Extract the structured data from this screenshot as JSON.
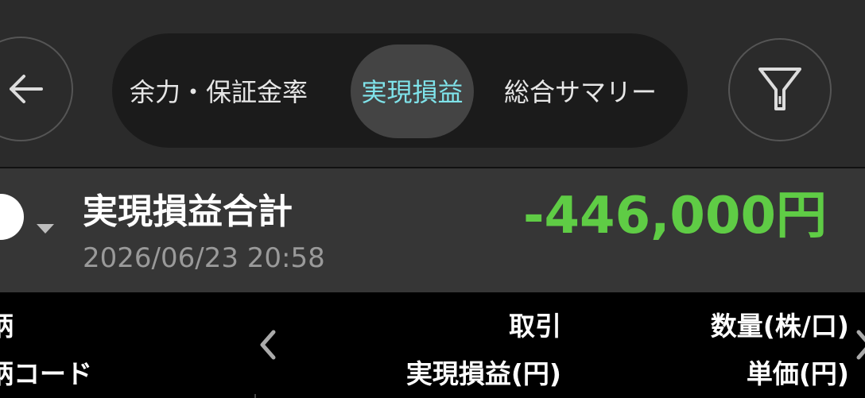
{
  "header": {
    "tabs": [
      {
        "label": "余力・保証金率",
        "active": false
      },
      {
        "label": "実現損益",
        "active": true
      },
      {
        "label": "総合サマリー",
        "active": false
      }
    ],
    "back_icon": "arrow-left-icon",
    "filter_icon": "filter-icon"
  },
  "summary": {
    "title": "実現損益合計",
    "timestamp": "2026/06/23 20:58",
    "amount": "-446,000円",
    "amount_color": "#5fcc45"
  },
  "table_header": {
    "col1_line1": "柄",
    "col1_line2": "柄コード",
    "col2_line1": "取引",
    "col2_line2": "実現損益(円)",
    "col3_line1": "数量(株/口)",
    "col3_line2": "単価(円)"
  },
  "colors": {
    "accent": "#7fe3ea",
    "header_bg": "#2b2b2b",
    "summary_bg": "#363636"
  }
}
